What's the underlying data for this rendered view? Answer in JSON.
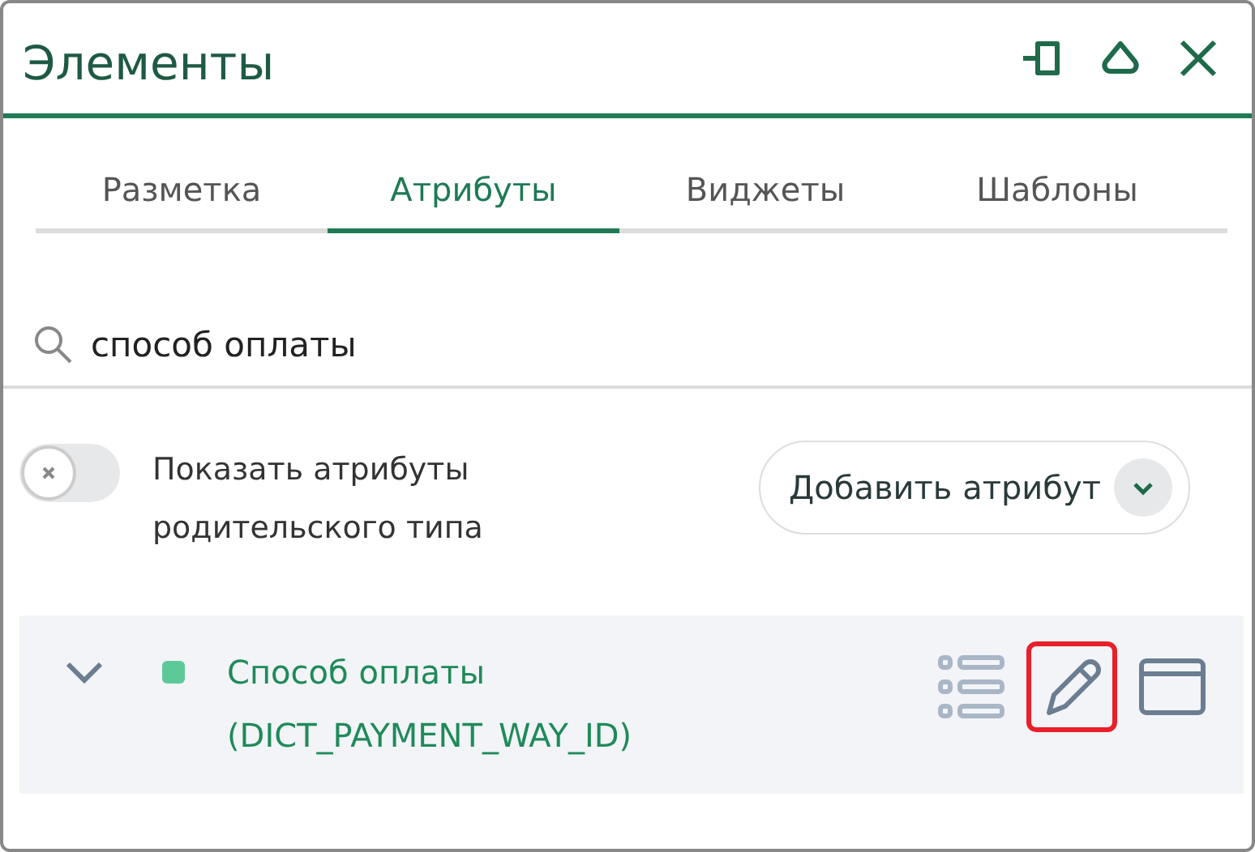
{
  "window": {
    "title": "Элементы"
  },
  "tabs": [
    {
      "label": "Разметка",
      "selected": false
    },
    {
      "label": "Атрибуты",
      "selected": true
    },
    {
      "label": "Виджеты",
      "selected": false
    },
    {
      "label": "Шаблоны",
      "selected": false
    }
  ],
  "search": {
    "value": "способ оплаты"
  },
  "parent_toggle": {
    "label": "Показать атрибуты родительского типа",
    "on": false
  },
  "add_button": {
    "label": "Добавить атрибут"
  },
  "attributes": [
    {
      "name": "Способ оплаты",
      "code": "(DICT_PAYMENT_WAY_ID)",
      "color": "#5ec998",
      "expanded": false,
      "actions": [
        {
          "kind": "list",
          "highlighted": false
        },
        {
          "kind": "edit",
          "highlighted": true
        },
        {
          "kind": "window",
          "highlighted": false
        }
      ]
    }
  ]
}
